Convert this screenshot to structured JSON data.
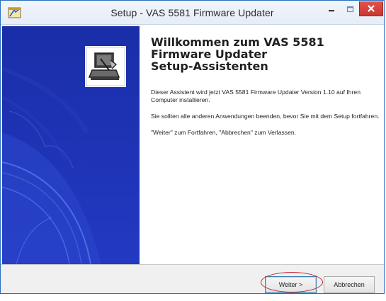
{
  "window": {
    "title": "Setup - VAS 5581 Firmware Updater",
    "icons": {
      "app": "setup-app-icon",
      "minimize": "minimize-icon",
      "maximize": "maximize-icon",
      "close": "close-icon"
    },
    "colors": {
      "close_button": "#d5443c",
      "side_panel": "#1b2fa8",
      "button_focus": "#3c7fb1",
      "annotation_ellipse": "#c0282d"
    }
  },
  "side_panel": {
    "icon": "computer-install-icon"
  },
  "welcome": {
    "heading": "Willkommen zum VAS 5581\nFirmware Updater\nSetup-Assistenten",
    "paragraphs": [
      "Dieser Assistent wird jetzt VAS 5581 Firmware Updater Version 1.10 auf Ihren Computer installieren.",
      "Sie sollten alle anderen Anwendungen beenden, bevor Sie mit dem Setup fortfahren.",
      "\"Weiter\" zum Fortfahren, \"Abbrechen\" zum Verlassen."
    ]
  },
  "buttons": {
    "next": "Weiter >",
    "cancel": "Abbrechen"
  }
}
